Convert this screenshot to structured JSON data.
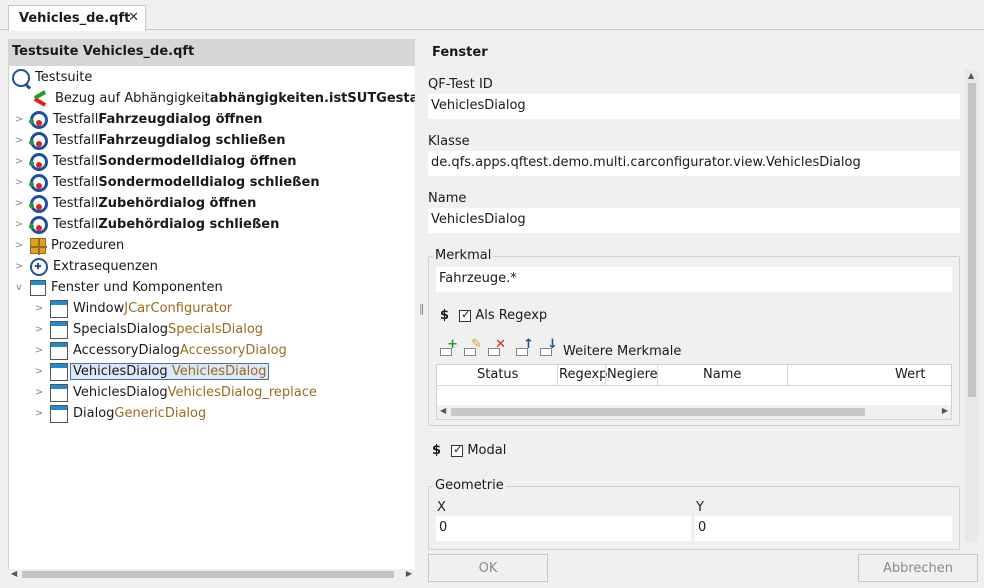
{
  "tab": {
    "title": "Vehicles_de.qft",
    "close": "✕"
  },
  "left": {
    "header": "Testsuite Vehicles_de.qft",
    "tree": [
      {
        "arrow": "",
        "icon": "testsuite-icon",
        "parts": [
          "Testsuite"
        ]
      },
      {
        "arrow": "",
        "icon": "dependency-ref-icon",
        "parts": [
          "Bezug auf Abhängigkeit ",
          "abhängigkeiten.istSUTGestartet"
        ]
      },
      {
        "arrow": ">",
        "icon": "testcase-icon",
        "parts": [
          "Testfall ",
          "Fahrzeugdialog öffnen"
        ]
      },
      {
        "arrow": ">",
        "icon": "testcase-icon",
        "parts": [
          "Testfall ",
          "Fahrzeugdialog schließen"
        ]
      },
      {
        "arrow": ">",
        "icon": "testcase-icon",
        "parts": [
          "Testfall ",
          "Sondermodelldialog öffnen"
        ]
      },
      {
        "arrow": ">",
        "icon": "testcase-icon",
        "parts": [
          "Testfall ",
          "Sondermodelldialog schließen"
        ]
      },
      {
        "arrow": ">",
        "icon": "testcase-icon",
        "parts": [
          "Testfall ",
          "Zubehördialog öffnen"
        ]
      },
      {
        "arrow": ">",
        "icon": "testcase-icon",
        "parts": [
          "Testfall ",
          "Zubehördialog schließen"
        ]
      },
      {
        "arrow": ">",
        "icon": "procedures-icon",
        "parts": [
          "Prozeduren"
        ]
      },
      {
        "arrow": ">",
        "icon": "extras-icon",
        "parts": [
          "Extrasequenzen"
        ]
      },
      {
        "arrow": "v",
        "icon": "windows-components-icon",
        "parts": [
          "Fenster und Komponenten"
        ]
      },
      {
        "arrow": ">",
        "icon": "window-icon",
        "parts": [
          "Window ",
          "JCarConfigurator"
        ]
      },
      {
        "arrow": ">",
        "icon": "window-icon",
        "parts": [
          "SpecialsDialog ",
          "SpecialsDialog"
        ]
      },
      {
        "arrow": ">",
        "icon": "window-icon",
        "parts": [
          "AccessoryDialog ",
          "AccessoryDialog"
        ]
      },
      {
        "arrow": ">",
        "icon": "window-icon",
        "parts": [
          "VehiclesDialog ",
          "VehiclesDialog"
        ]
      },
      {
        "arrow": ">",
        "icon": "window-icon",
        "parts": [
          "VehiclesDialog ",
          "VehiclesDialog_replace"
        ]
      },
      {
        "arrow": ">",
        "icon": "window-icon",
        "parts": [
          "Dialog ",
          "GenericDialog"
        ]
      }
    ]
  },
  "right": {
    "title": "Fenster",
    "qftest_id_label": "QF-Test ID",
    "qftest_id_value": "VehiclesDialog",
    "klasse_label": "Klasse",
    "klasse_value": "de.qfs.apps.qftest.demo.multi.carconfigurator.view.VehiclesDialog",
    "name_label": "Name",
    "name_value": "VehiclesDialog",
    "merkmal_label": "Merkmal",
    "merkmal_value": "Fahrzeuge.*",
    "dollar": "$",
    "regexp_label": "Als Regexp",
    "weitere_label": "Weitere Merkmale",
    "table_headers": [
      "Status",
      "Regexp",
      "Negiere",
      "Name",
      "Wert"
    ],
    "modal_label": "Modal",
    "geometrie_label": "Geometrie",
    "x_label": "X",
    "x_value": "0",
    "y_label": "Y",
    "y_value": "0",
    "ok_label": "OK",
    "cancel_label": "Abbrechen"
  },
  "colors": {
    "accent": "#1f4f9e",
    "brown": "#9a6a1e",
    "selection": "#dbe8f8"
  }
}
